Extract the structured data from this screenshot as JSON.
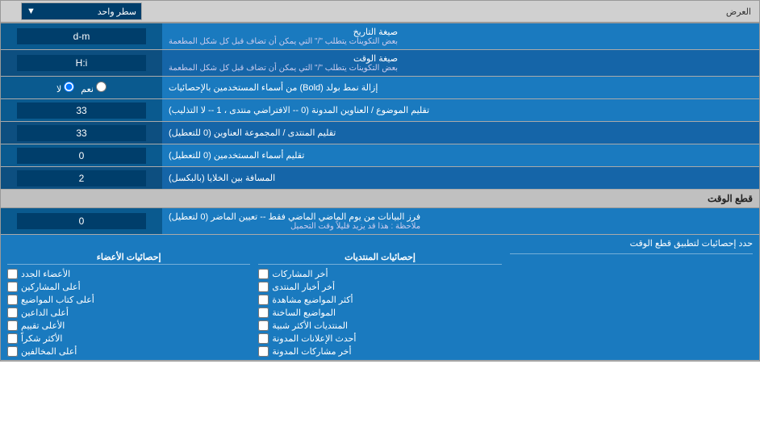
{
  "header": {
    "label": "العرض",
    "dropdown_label": "سطر واحد"
  },
  "rows": [
    {
      "id": "date_format",
      "label": "صيغة التاريخ",
      "sublabel": "بعض التكوينات يتطلب \"/\" التي يمكن أن تضاف قبل كل شكل المطعمة",
      "value": "d-m",
      "type": "text"
    },
    {
      "id": "time_format",
      "label": "صيغة الوقت",
      "sublabel": "بعض التكوينات يتطلب \"/\" التي يمكن أن تضاف قبل كل شكل المطعمة",
      "value": "H:i",
      "type": "text"
    },
    {
      "id": "remove_bold",
      "label": "إزالة نمط بولد (Bold) من أسماء المستخدمين بالإحصائيات",
      "value_yes": "نعم",
      "value_no": "لا",
      "type": "radio",
      "selected": "no"
    },
    {
      "id": "topics_trim",
      "label": "تقليم الموضوع / العناوين المدونة (0 -- الافتراضي منتدى ، 1 -- لا التذليب)",
      "value": "33",
      "type": "text"
    },
    {
      "id": "forum_trim",
      "label": "تقليم المنتدى / المجموعة العناوين (0 للتعطيل)",
      "value": "33",
      "type": "text"
    },
    {
      "id": "usernames_trim",
      "label": "تقليم أسماء المستخدمين (0 للتعطيل)",
      "value": "0",
      "type": "text"
    },
    {
      "id": "cell_spacing",
      "label": "المسافة بين الخلايا (بالبكسل)",
      "value": "2",
      "type": "text"
    }
  ],
  "time_cut_section": {
    "title": "قطع الوقت",
    "row": {
      "id": "time_filter",
      "label": "فرز البيانات من يوم الماضي الماضي فقط -- تعيين الماضر (0 لتعطيل)",
      "sublabel": "ملاحظة : هذا قد يزيد قليلاً وقت التحميل",
      "value": "0",
      "type": "text"
    },
    "checkbox_header": "حدد إحصائيات لتطبيق قطع الوقت"
  },
  "checkboxes": {
    "col1_header": "إحصائيات الأعضاء",
    "col1_items": [
      "الأعضاء الجدد",
      "أعلى المشاركين",
      "أعلى كتاب المواضيع",
      "أعلى الداعين",
      "الأعلى تقييم",
      "الأكثر شكراً",
      "أعلى المخالفين"
    ],
    "col2_header": "إحصائيات المنتديات",
    "col2_items": [
      "أخر المشاركات",
      "أخر أخبار المنتدى",
      "أكثر المواضيع مشاهدة",
      "المواضيع الساخنة",
      "المنتديات الأكثر شبية",
      "أحدث الإعلانات المدونة",
      "أخر مشاركات المدونة"
    ],
    "col3_header": "",
    "col3_items": []
  }
}
